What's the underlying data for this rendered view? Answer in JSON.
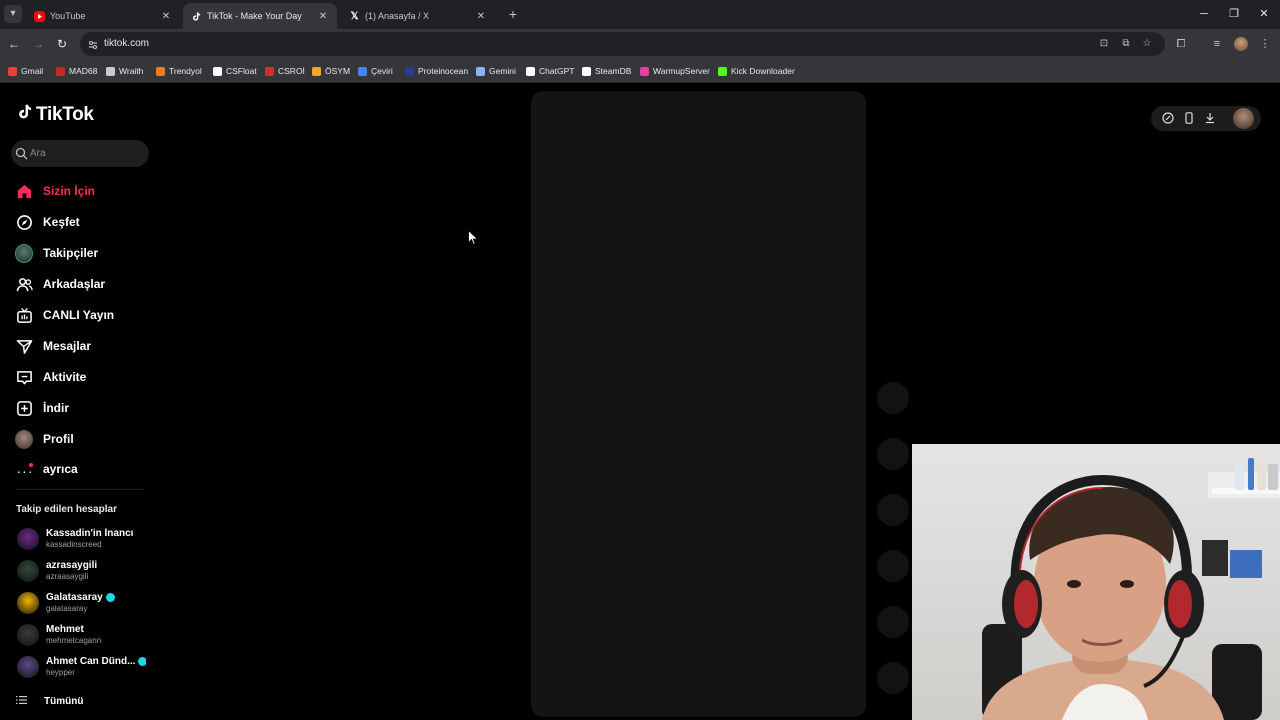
{
  "browser": {
    "tabs": [
      {
        "title": "YouTube",
        "active": false,
        "favicon": "youtube-icon",
        "color": "#ff0000"
      },
      {
        "title": "TikTok - Make Your Day",
        "active": true,
        "favicon": "tiktok-icon",
        "color": "#ffffff"
      },
      {
        "title": "(1) Anasayfa / X",
        "active": false,
        "favicon": "x-icon",
        "color": "#ffffff"
      }
    ],
    "url": "tiktok.com",
    "bookmarks": [
      {
        "label": "Gmail",
        "icon": "gmail-icon",
        "color": "#ea4335"
      },
      {
        "label": "MAD68",
        "icon": "mad68-icon",
        "color": "#c62828"
      },
      {
        "label": "Wraith",
        "icon": "wraith-icon",
        "color": "#c9c9c9"
      },
      {
        "label": "Trendyol",
        "icon": "trendyol-icon",
        "color": "#f27a1a"
      },
      {
        "label": "CSFloat",
        "icon": "csfloat-icon",
        "color": "#ffffff"
      },
      {
        "label": "CSROİ",
        "icon": "csroi-icon",
        "color": "#d32f2f"
      },
      {
        "label": "ÖSYM",
        "icon": "osym-icon",
        "color": "#f5a623"
      },
      {
        "label": "Çeviri",
        "icon": "google-translate-icon",
        "color": "#4285f4"
      },
      {
        "label": "Proteinocean",
        "icon": "proteinocean-icon",
        "color": "#2b3a8f"
      },
      {
        "label": "Gemini",
        "icon": "gemini-icon",
        "color": "#8ab4f8"
      },
      {
        "label": "ChatGPT",
        "icon": "chatgpt-icon",
        "color": "#ffffff"
      },
      {
        "label": "SteamDB",
        "icon": "steamdb-icon",
        "color": "#ffffff"
      },
      {
        "label": "WarmupServer",
        "icon": "warmupserver-icon",
        "color": "#e040a0"
      },
      {
        "label": "Kick Downloader",
        "icon": "kick-icon",
        "color": "#53fc18"
      }
    ]
  },
  "tiktok": {
    "logo": "TikTok",
    "search_placeholder": "Ara",
    "accent": "#fe2c55",
    "nav": [
      {
        "label": "Sizin İçin",
        "icon": "home-icon",
        "active": true
      },
      {
        "label": "Keşfet",
        "icon": "compass-icon",
        "active": false
      },
      {
        "label": "Takipçiler",
        "icon": "followers-avatar-icon",
        "active": false
      },
      {
        "label": "Arkadaşlar",
        "icon": "friends-icon",
        "active": false
      },
      {
        "label": "CANLI Yayın",
        "icon": "live-tv-icon",
        "active": false
      },
      {
        "label": "Mesajlar",
        "icon": "messages-icon",
        "active": false
      },
      {
        "label": "Aktivite",
        "icon": "activity-icon",
        "active": false
      },
      {
        "label": "İndir",
        "icon": "plus-box-icon",
        "active": false
      },
      {
        "label": "Profil",
        "icon": "profile-avatar-icon",
        "active": false
      },
      {
        "label": "ayrıca",
        "icon": "more-dots-icon",
        "active": false
      }
    ],
    "following_title": "Takip edilen hesaplar",
    "following": [
      {
        "name": "Kassadin'in İnancı",
        "username": "kassadinscreed",
        "verified": false,
        "avatar_color": "#6a2a8a"
      },
      {
        "name": "azrasaygili",
        "username": "azraasaygili",
        "verified": false,
        "avatar_color": "#2e4a3a"
      },
      {
        "name": "Galatasaray",
        "username": "galatasaray",
        "verified": true,
        "avatar_color": "#f4b400"
      },
      {
        "name": "Mehmet",
        "username": "mehmetcagann",
        "verified": false,
        "avatar_color": "#3a3a3a"
      },
      {
        "name": "Ahmet Can Dünd...",
        "username": "heypper",
        "verified": true,
        "avatar_color": "#5a4a8a"
      }
    ],
    "see_all": "Tümünü"
  }
}
